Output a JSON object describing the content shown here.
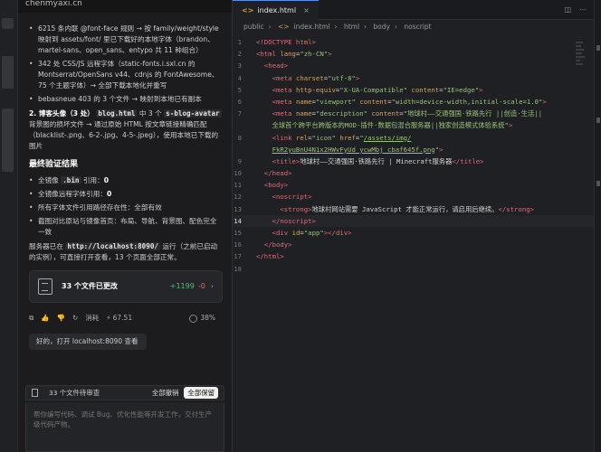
{
  "chat": {
    "title": "chenmyaxi.cn",
    "bullets_top": [
      "6215 条内联 @font-face 规则 → 按 family/weight/style 映射到 assets/font/ 里已下载好的本地字体（brandon、martel-sans、open_sans、entypo 共 11 种组合）",
      "342 处 CSS/JS 远程字体（static-fonts.i.sxl.cn 的 Montserrat/OpenSans v44、cdnjs 的 FontAwesome、75 个主题字体）→ 全部下载本地化并重写",
      "bebasneue 403 的 3 个文件 → 映射到本地已有副本"
    ],
    "section2_title": "2. 博客头像（3 处）",
    "section2_code1": "blog.html",
    "section2_mid": " 中 3 个 ",
    "section2_code2": "s-blog-avatar",
    "section2_text": " 背景图的损坏文件 → 通过原始 HTML 按文章链接精确匹配（blacklist-.png、6-2-.jpg、4-5-.jpeg），使用本地已下载的图片",
    "verify_title": "最终验证结果",
    "verify_items": [
      {
        "text": "全镜像 ",
        "code": ".bin",
        "rest": " 引用：",
        "count": "0"
      },
      {
        "text": "全镜像远程字体引用：",
        "count": "0"
      },
      {
        "text": "所有字体文件引用路径存在性：全部有效"
      },
      {
        "text": "截图对比原站与镜像首页：布局、导航、背景图、配色完全一致"
      }
    ],
    "server_pre": "服务器已在 ",
    "server_url": "http://localhost:8090/",
    "server_post": " 运行（之前已启动的实例），可直接打开查看，13 个页面全部正常。",
    "file_card": {
      "label": "33 个文件已更改",
      "plus": "+1199",
      "minus": "-0"
    },
    "meta": {
      "undo": "消耗",
      "tokens": "67.51",
      "percent": "38%"
    },
    "reply_chip": "好的，打开 localhost:8090 查看",
    "review_bar": {
      "label": "33 个文件待审查",
      "undo_all": "全部撤销",
      "keep_all": "全部保留"
    },
    "composer_placeholder": "帮你编写代码、调试 Bug、优化性能等开发工作，交付生产级代码产物。"
  },
  "editor": {
    "tab_label": "index.html",
    "breadcrumb": [
      "public",
      "index.html",
      "html",
      "body",
      "noscript"
    ],
    "active_line": 14
  },
  "code_lines": [
    {
      "n": "1"
    },
    {
      "n": "2"
    },
    {
      "n": "3"
    },
    {
      "n": "4"
    },
    {
      "n": "5"
    },
    {
      "n": "6"
    },
    {
      "n": "7"
    },
    {
      "n": ""
    },
    {
      "n": "8"
    },
    {
      "n": ""
    },
    {
      "n": "9"
    },
    {
      "n": "10"
    },
    {
      "n": "11"
    },
    {
      "n": "12"
    },
    {
      "n": "13"
    },
    {
      "n": "14"
    },
    {
      "n": "15"
    },
    {
      "n": "16"
    },
    {
      "n": "17"
    },
    {
      "n": "18"
    }
  ],
  "code_text": {
    "l1": "<!DOCTYPE html>",
    "l2_lang": "zh-CN",
    "l4_charset": "utf-8",
    "l5_equiv": "X-UA-Compatible",
    "l5_content": "IE=edge",
    "l6_name": "viewport",
    "l6_content": "width=device-width,initial-scale=1.0",
    "l7_name": "description",
    "l7_content_a": "地球村——交通强国·铁路先行 ||创造·生活||",
    "l7_content_b": "全球首个跨平台跨版本的MOD·插件·数据包混合服务器||独家创造模式体验系统",
    "l8_rel": "icon",
    "l8_href_a": "/assets/img/",
    "l8_href_b": "FkR2yuBnU4N1x2HWvFyUd_ycwMbj_cbaf645f.png",
    "l9_title": "地球村——交通强国·铁路先行 | Minecraft服务器",
    "l13_strong": "地球村网站需要 JavaScript 才能正常运行，请启用后继续。",
    "l15_id": "app"
  }
}
